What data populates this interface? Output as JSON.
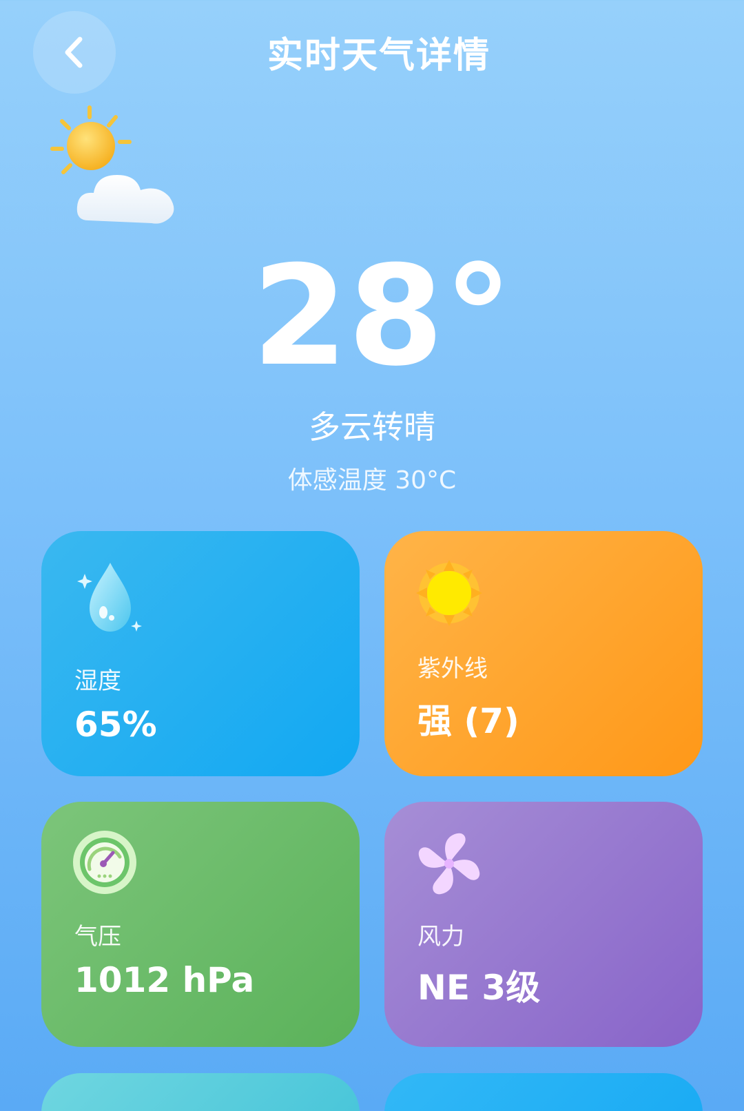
{
  "header": {
    "title": "实时天气详情"
  },
  "current": {
    "temperature": "28°",
    "condition": "多云转晴",
    "feels_like": "体感温度 30°C"
  },
  "cards": {
    "humidity": {
      "label": "湿度",
      "value": "65%"
    },
    "uv": {
      "label": "紫外线",
      "value": "强 (7)"
    },
    "pressure": {
      "label": "气压",
      "value": "1012 hPa"
    },
    "wind": {
      "label": "风力",
      "value": "NE 3级"
    }
  },
  "icons": {
    "back": "chevron-left-icon",
    "weather": "partly-cloudy-icon",
    "humidity": "water-drop-icon",
    "uv": "sun-icon",
    "pressure": "gauge-icon",
    "wind": "pinwheel-icon"
  }
}
